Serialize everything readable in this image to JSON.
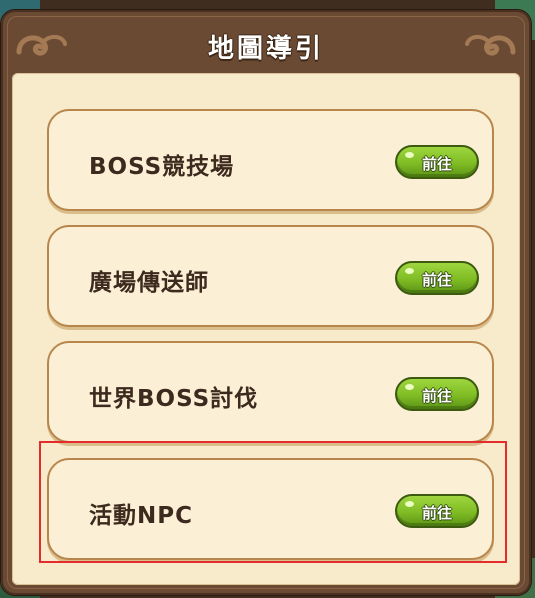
{
  "dialog": {
    "title": "地圖導引"
  },
  "options": [
    {
      "label": "BOSS競技場",
      "button_label": "前往"
    },
    {
      "label": "廣場傳送師",
      "button_label": "前往"
    },
    {
      "label": "世界BOSS討伐",
      "button_label": "前往"
    },
    {
      "label": "活動NPC",
      "button_label": "前往"
    }
  ],
  "highlight": {
    "target": "活動NPC",
    "color": "#e52c2c"
  },
  "colors": {
    "frame": "#6b4a34",
    "panel": "#f8ebcb",
    "card_border": "#b8864c",
    "button_green": "#7fbc24"
  },
  "icons": {
    "title_ornament": "swirl-ornament-icon"
  }
}
